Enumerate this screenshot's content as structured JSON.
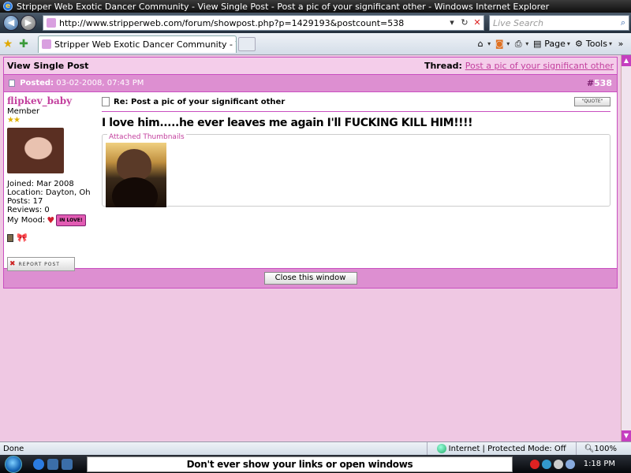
{
  "window": {
    "title": "Stripper Web Exotic Dancer Community - View Single Post - Post a pic of your significant other - Windows Internet Explorer"
  },
  "nav": {
    "url": "http://www.stripperweb.com/forum/showpost.php?p=1429193&postcount=538",
    "search_placeholder": "Live Search"
  },
  "tabs": {
    "active_label": "Stripper Web Exotic Dancer Community - View Si..."
  },
  "commands": {
    "page": "Page",
    "tools": "Tools"
  },
  "post": {
    "header_title": "View Single Post",
    "thread_label": "Thread:",
    "thread_link": "Post a pic of your significant other",
    "posted_label": "Posted:",
    "posted_date": "03-02-2008, 07:43 PM",
    "post_number_prefix": "#",
    "post_number": "538",
    "title": "Re: Post a pic of your significant other",
    "quote_label": "\"QUOTE\"",
    "message": "I love him.....he ever leaves me again I'll FUCKING KILL HIM!!!!",
    "attachments_label": "Attached Thumbnails",
    "close_label": "Close this window"
  },
  "user": {
    "name": "flipkev_baby",
    "title": "Member",
    "stars": "★★",
    "joined": "Joined: Mar 2008",
    "location": "Location: Dayton, Oh",
    "posts": "Posts: 17",
    "reviews": "Reviews: 0",
    "mood_label": "My Mood:",
    "mood_value": "IN LOVE!",
    "report_label": "REPORT POST"
  },
  "status": {
    "text": "Done",
    "zone": "Internet | Protected Mode: Off",
    "zoom": "100%"
  },
  "taskbar": {
    "caption": "Don't ever show your links or open windows",
    "clock": "1:18 PM"
  }
}
